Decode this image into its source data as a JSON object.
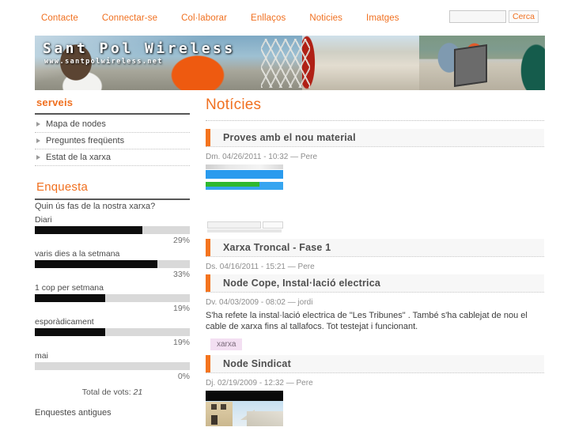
{
  "nav": {
    "items": [
      {
        "label": "Contacte"
      },
      {
        "label": "Connectar-se"
      },
      {
        "label": "Col·laborar"
      },
      {
        "label": "Enllaços"
      },
      {
        "label": "Noticies"
      },
      {
        "label": "Imatges"
      }
    ]
  },
  "search": {
    "value": "",
    "placeholder": "",
    "button_label": "Cerca"
  },
  "banner": {
    "title": "Sant Pol Wireless",
    "subtitle": "www.santpolwireless.net"
  },
  "sidebar": {
    "services": {
      "title": "serveis",
      "items": [
        {
          "label": "Mapa de nodes"
        },
        {
          "label": "Preguntes freqüents"
        },
        {
          "label": "Estat de la xarxa"
        }
      ]
    },
    "poll": {
      "title": "Enquesta",
      "question": "Quin ús fas de la nostra xarxa?",
      "options": [
        {
          "label": "Diari",
          "percent": "29%",
          "value": 29
        },
        {
          "label": "varis dies a la setmana",
          "percent": "33%",
          "value": 33
        },
        {
          "label": "1 cop per setmana",
          "percent": "19%",
          "value": 19
        },
        {
          "label": "esporàdicament",
          "percent": "19%",
          "value": 19
        },
        {
          "label": "mai",
          "percent": "0%",
          "value": 0
        }
      ],
      "total_label": "Total de vots:",
      "total_value": "21",
      "older_link": "Enquestes antigues"
    }
  },
  "main": {
    "page_title": "Notícies",
    "articles": [
      {
        "title": "Proves amb el nou material",
        "submitted": "Dm. 04/26/2011 - 10:32 — Pere",
        "body": "",
        "has_screenshot_thumb": true,
        "has_photo_thumb": false,
        "tags": []
      },
      {
        "title": "Xarxa Troncal - Fase 1",
        "submitted": "Ds. 04/16/2011 - 15:21 — Pere",
        "body": "",
        "has_screenshot_thumb": false,
        "has_photo_thumb": false,
        "tags": []
      },
      {
        "title": "Node Cope, Instal·lació electrica",
        "submitted": "Dv. 04/03/2009 - 08:02 — jordi",
        "body": "S'ha refete la instal·lació electrica de \"Les Tribunes\" . També s'ha cablejat de nou el cable de xarxa fins al tallafocs. Tot testejat i funcionant.",
        "has_screenshot_thumb": false,
        "has_photo_thumb": false,
        "tags": [
          {
            "label": "xarxa"
          }
        ]
      },
      {
        "title": "Node Sindicat",
        "submitted": "Dj. 02/19/2009 - 12:32 — Pere",
        "body": "",
        "has_screenshot_thumb": false,
        "has_photo_thumb": true,
        "tags": []
      }
    ]
  },
  "colors": {
    "accent_orange": "#f07020",
    "marker_orange": "#f4741e",
    "bar_fill": "#0d0d0d",
    "bar_track": "#d9d9d9",
    "tag_bg": "#f3dff2"
  }
}
